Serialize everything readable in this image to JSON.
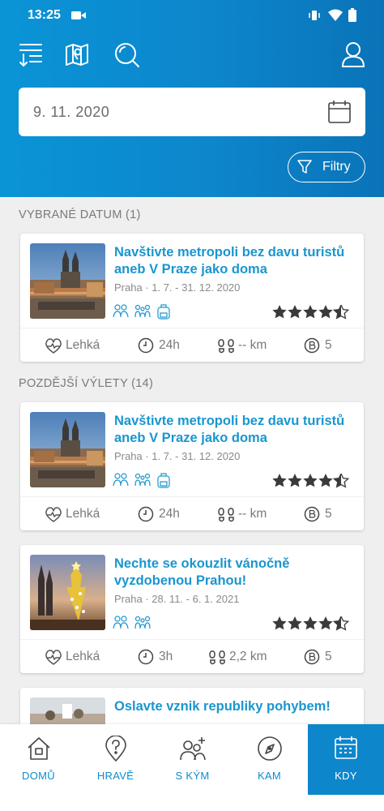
{
  "status_bar": {
    "time": "13:25"
  },
  "header": {
    "icons": [
      "sort-icon",
      "map-icon",
      "search-icon",
      "profile-icon"
    ],
    "date_value": "9. 11. 2020",
    "filter_label": "Filtry",
    "colors": {
      "header_blue": "#0d86cc",
      "title_blue": "#1996cf"
    }
  },
  "sections": [
    {
      "label": "VYBRANÉ DATUM (1)"
    },
    {
      "label": "POZDĚJŠÍ VÝLETY (14)"
    }
  ],
  "cards": [
    {
      "title_line1": "Navštivte metropoli bez davu turistů",
      "title_line2": "aneb V Praze jako doma",
      "subtitle": "Praha · 1. 7. - 31. 12. 2020",
      "rating": 4.5,
      "audience_icons": [
        "couple-icon",
        "family-icon",
        "backpack-icon"
      ],
      "difficulty": "Lehká",
      "duration": "24h",
      "distance": "-- km",
      "points": "5"
    },
    {
      "title_line1": "Navštivte metropoli bez davu turistů",
      "title_line2": "aneb V Praze jako doma",
      "subtitle": "Praha · 1. 7. - 31. 12. 2020",
      "rating": 4.5,
      "audience_icons": [
        "couple-icon",
        "family-icon",
        "backpack-icon"
      ],
      "difficulty": "Lehká",
      "duration": "24h",
      "distance": "-- km",
      "points": "5"
    },
    {
      "title_line1": "Nechte se okouzlit vánočně",
      "title_line2": "vyzdobenou Prahou!",
      "subtitle": "Praha · 28. 11. - 6. 1. 2021",
      "rating": 4.5,
      "audience_icons": [
        "couple-icon",
        "family-icon"
      ],
      "difficulty": "Lehká",
      "duration": "3h",
      "distance": "2,2 km",
      "points": "5"
    },
    {
      "title_line1": "Oslavte vznik republiky pohybem!"
    }
  ],
  "bottom_nav": [
    {
      "label": "DOMŮ",
      "icon": "home-icon"
    },
    {
      "label": "HRAVĚ",
      "icon": "location-question-icon"
    },
    {
      "label": "S KÝM",
      "icon": "add-people-icon"
    },
    {
      "label": "KAM",
      "icon": "compass-icon"
    },
    {
      "label": "KDY",
      "icon": "calendar-icon",
      "active": true
    }
  ]
}
